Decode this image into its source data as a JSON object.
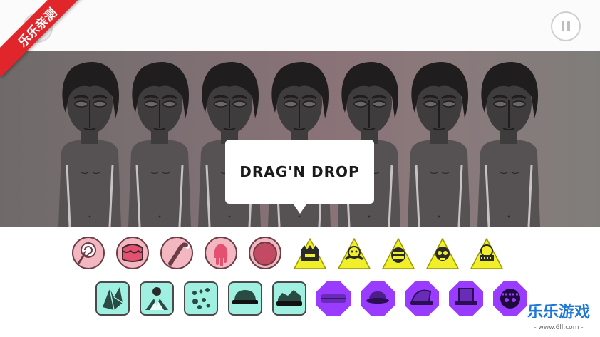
{
  "ribbon": {
    "text": "乐乐亲测"
  },
  "tooltip": {
    "text": "DRAG'N DROP"
  },
  "stage": {
    "singer_count": 7
  },
  "colors": {
    "effects": "#f2b7c0",
    "beats": "#f0ef2a",
    "melodies": "#9ff0e0",
    "voices": "#9a3cff"
  },
  "tray": {
    "row1": [
      {
        "kind": "effect",
        "icon": "lollipop-icon"
      },
      {
        "kind": "effect",
        "icon": "cake-icon"
      },
      {
        "kind": "effect",
        "icon": "candy-cane-icon"
      },
      {
        "kind": "effect",
        "icon": "popsicle-icon"
      },
      {
        "kind": "effect",
        "icon": "jelly-icon"
      },
      {
        "kind": "beat",
        "icon": "crown-face-icon"
      },
      {
        "kind": "beat",
        "icon": "mustache-face-icon"
      },
      {
        "kind": "beat",
        "icon": "bee-face-icon"
      },
      {
        "kind": "beat",
        "icon": "skull-face-icon"
      },
      {
        "kind": "beat",
        "icon": "robot-face-icon"
      }
    ],
    "row2": [
      {
        "kind": "melody",
        "icon": "shards-icon"
      },
      {
        "kind": "melody",
        "icon": "collar-icon"
      },
      {
        "kind": "melody",
        "icon": "dots-icon"
      },
      {
        "kind": "melody",
        "icon": "cap-icon"
      },
      {
        "kind": "melody",
        "icon": "torn-cap-icon"
      },
      {
        "kind": "voice",
        "icon": "band-icon"
      },
      {
        "kind": "voice",
        "icon": "bowl-hat-icon"
      },
      {
        "kind": "voice",
        "icon": "wizard-hat-icon"
      },
      {
        "kind": "voice",
        "icon": "top-hat-icon"
      },
      {
        "kind": "voice",
        "icon": "helmet-face-icon"
      }
    ]
  },
  "watermark": {
    "brand": "乐乐游戏",
    "url": "- www.6ll.com -"
  }
}
